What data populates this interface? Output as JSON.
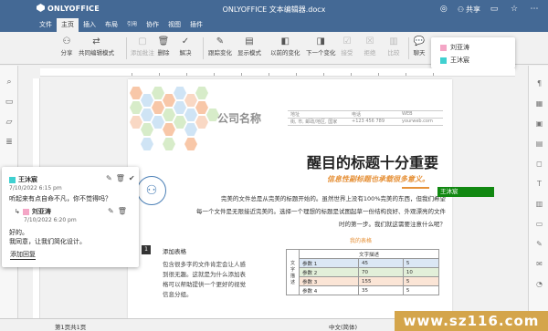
{
  "app": {
    "brand": "ONLYOFFICE",
    "doc_title": "ONLYOFFICE 文本编辑器.docx",
    "share_label": "共享"
  },
  "menu": {
    "tabs": [
      "文件",
      "主页",
      "插入",
      "布局",
      "引用",
      "协作",
      "视图",
      "插件"
    ],
    "active": "主页"
  },
  "toolbar": {
    "share": "分享",
    "co_edit_mode": "共同编辑模式",
    "add_comment": "添加批注",
    "delete": "删除",
    "resolve": "解决",
    "track_changes": "跟踪变化",
    "display_mode": "显示模式",
    "previous_change": "以前的变化",
    "next_change": "下一个变化",
    "accept": "接受",
    "reject": "拒绝",
    "compare": "比较",
    "chat": "聊天"
  },
  "users": [
    {
      "name": "刘亚涛",
      "color": "#f4a6c6"
    },
    {
      "name": "王沐宸",
      "color": "#40d0d0"
    }
  ],
  "document": {
    "company": "公司名称",
    "header_cols": [
      "地址",
      "电话",
      "WEB"
    ],
    "header_values": [
      "街, 市, 邮政/地区, 国家",
      "+123 456 789",
      "yourweb.com"
    ],
    "title": "醒目的标题十分重要",
    "subtitle": "信息性副标题也承载很多意义。",
    "lines": [
      "完美的文件总是从完美的标题开始的。虽然世界上没有100%完美的东西，但我们希望",
      "每一个文件是无限接近完美的。选择一个理想的标题是试图起草一份结构良好、外观漂亮的文件",
      "时的第一步。我们就这需要注意什么呢？"
    ],
    "section_link": "我的表格",
    "item_number": "1",
    "item_title": "添加表格",
    "item_paras": [
      "包含很多字的文件肯定会让人感",
      "到很无趣。这就是为什么添加表",
      "格可以帮助提供一个更好的视觉",
      "信息分组。"
    ],
    "table": {
      "header": "文字描述",
      "row_header": "文字描述",
      "rows": [
        {
          "label": "参数 1",
          "a": "45",
          "b": "5",
          "color": "#dbe7f5"
        },
        {
          "label": "参数 2",
          "a": "70",
          "b": "10",
          "color": "#e2efd9"
        },
        {
          "label": "参数 3",
          "a": "155",
          "b": "5",
          "color": "#fbe5d6"
        },
        {
          "label": "参数 4",
          "a": "35",
          "b": "5",
          "color": "#ffffff"
        }
      ]
    }
  },
  "comments": [
    {
      "author": "王沐宸",
      "color": "#40d0d0",
      "date": "7/10/2022  6:15 pm",
      "text": "听起来有点自命不凡，你不觉得吗？"
    },
    {
      "author": "刘亚涛",
      "color": "#f4a6c6",
      "date": "7/10/2022  6:20 pm",
      "text_1": "好的。",
      "text_2": "我同意，让我们简化设计。"
    }
  ],
  "comment_reply": "添加回复",
  "cursor_user": "王沐宸",
  "status": {
    "page": "第1页共1页",
    "language": "中文(简体)"
  },
  "watermark": "www.sz116.com"
}
